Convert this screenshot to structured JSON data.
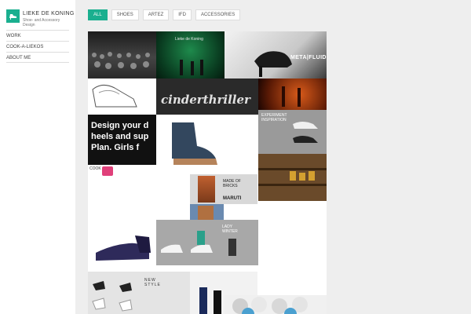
{
  "brand": {
    "name": "LIEKE DE KONING",
    "tagline": "Shoe- and Accessory Design",
    "logo_icon": "shoe-logo-icon",
    "accent": "#1aaf8f"
  },
  "nav": {
    "items": [
      {
        "label": "WORK"
      },
      {
        "label": "COOK-A-LIEKOS"
      },
      {
        "label": "ABOUT ME"
      }
    ]
  },
  "filters": {
    "active": "ALL",
    "items": [
      {
        "label": "ALL"
      },
      {
        "label": "SHOES"
      },
      {
        "label": "ARTEZ"
      },
      {
        "label": "IFD"
      },
      {
        "label": "ACCESSORIES"
      }
    ]
  },
  "tiles": {
    "banner_name": "Lieke de Koning",
    "metafluid": "META|FLUID",
    "cinderthriller": "cinderthriller",
    "experiment": "EXPERIMENT INSPIRATION",
    "design_line1": "Design your d",
    "design_line2": "heels and sup",
    "design_line3": "Plan. Girls f",
    "bricks": "MADE OF BRICKS",
    "bricks_sub": "MARUTI",
    "lady_winter": "LADY WINTER",
    "new_style": "NEW STYLE",
    "cookie": "COOK"
  }
}
